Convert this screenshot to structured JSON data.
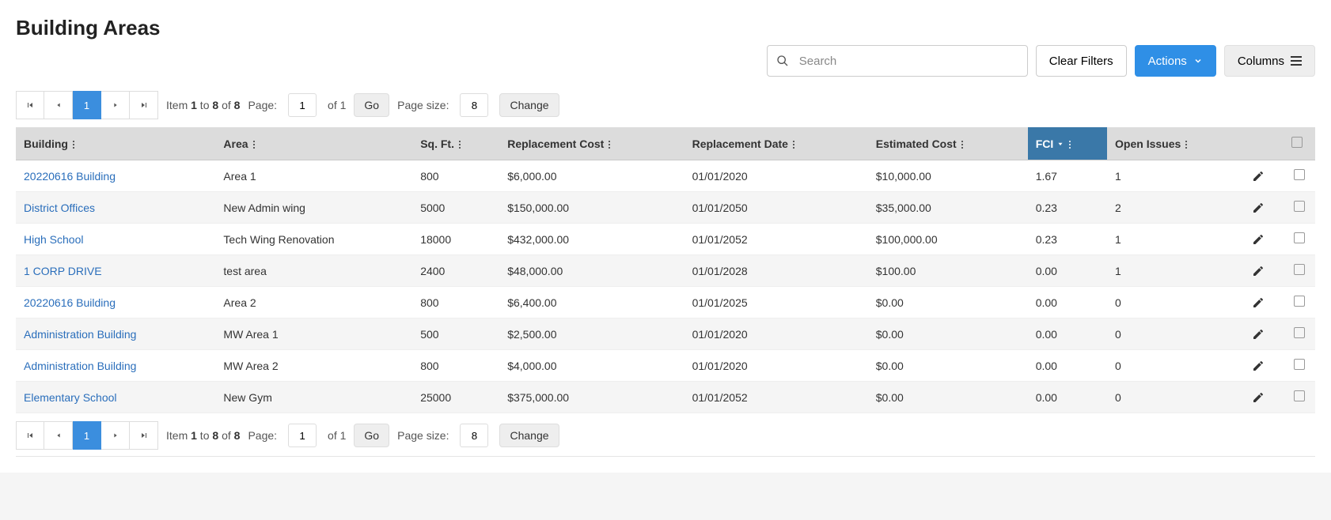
{
  "title": "Building Areas",
  "toolbar": {
    "search_placeholder": "Search",
    "clear_filters": "Clear Filters",
    "actions": "Actions",
    "columns": "Columns"
  },
  "pager": {
    "current_page": "1",
    "item_label_prefix": "Item ",
    "from": "1",
    "to_sep": " to ",
    "to": "8",
    "of_sep": " of ",
    "total": "8",
    "page_label": "Page:",
    "page_input": "1",
    "of_pages_prefix": " of ",
    "of_pages": "1",
    "go": "Go",
    "pagesize_label": "Page size:",
    "pagesize_input": "8",
    "change": "Change"
  },
  "columns": [
    {
      "label": "Building",
      "sorted": false
    },
    {
      "label": "Area",
      "sorted": false
    },
    {
      "label": "Sq. Ft.",
      "sorted": false
    },
    {
      "label": "Replacement Cost",
      "sorted": false
    },
    {
      "label": "Replacement Date",
      "sorted": false
    },
    {
      "label": "Estimated Cost",
      "sorted": false
    },
    {
      "label": "FCI",
      "sorted": true,
      "dir": "desc"
    },
    {
      "label": "Open Issues",
      "sorted": false
    }
  ],
  "rows": [
    {
      "building": "20220616 Building",
      "area": "Area 1",
      "sqft": "800",
      "repl_cost": "$6,000.00",
      "repl_date": "01/01/2020",
      "est_cost": "$10,000.00",
      "fci": "1.67",
      "open_issues": "1"
    },
    {
      "building": "District Offices",
      "area": "New Admin wing",
      "sqft": "5000",
      "repl_cost": "$150,000.00",
      "repl_date": "01/01/2050",
      "est_cost": "$35,000.00",
      "fci": "0.23",
      "open_issues": "2"
    },
    {
      "building": "High School",
      "area": "Tech Wing Renovation",
      "sqft": "18000",
      "repl_cost": "$432,000.00",
      "repl_date": "01/01/2052",
      "est_cost": "$100,000.00",
      "fci": "0.23",
      "open_issues": "1"
    },
    {
      "building": "1 CORP DRIVE",
      "area": "test area",
      "sqft": "2400",
      "repl_cost": "$48,000.00",
      "repl_date": "01/01/2028",
      "est_cost": "$100.00",
      "fci": "0.00",
      "open_issues": "1"
    },
    {
      "building": "20220616 Building",
      "area": "Area 2",
      "sqft": "800",
      "repl_cost": "$6,400.00",
      "repl_date": "01/01/2025",
      "est_cost": "$0.00",
      "fci": "0.00",
      "open_issues": "0"
    },
    {
      "building": "Administration Building",
      "area": "MW Area 1",
      "sqft": "500",
      "repl_cost": "$2,500.00",
      "repl_date": "01/01/2020",
      "est_cost": "$0.00",
      "fci": "0.00",
      "open_issues": "0"
    },
    {
      "building": "Administration Building",
      "area": "MW Area 2",
      "sqft": "800",
      "repl_cost": "$4,000.00",
      "repl_date": "01/01/2020",
      "est_cost": "$0.00",
      "fci": "0.00",
      "open_issues": "0"
    },
    {
      "building": "Elementary School",
      "area": "New Gym",
      "sqft": "25000",
      "repl_cost": "$375,000.00",
      "repl_date": "01/01/2052",
      "est_cost": "$0.00",
      "fci": "0.00",
      "open_issues": "0"
    }
  ]
}
